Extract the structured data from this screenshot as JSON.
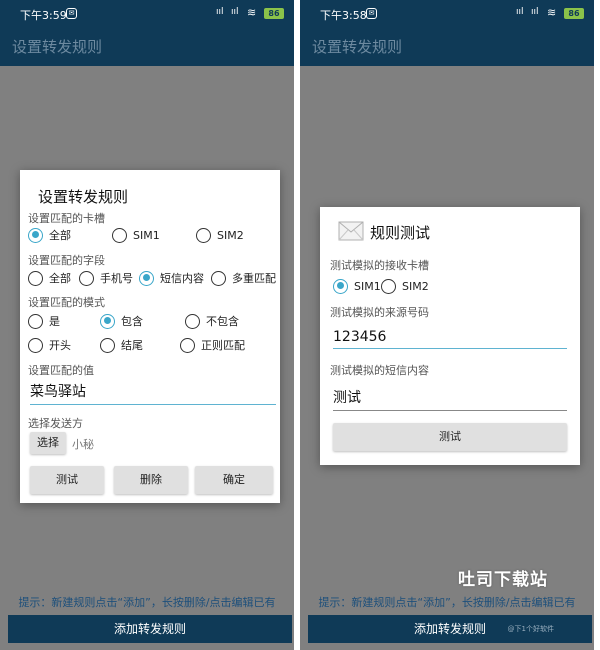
{
  "left": {
    "status": {
      "time": "下午3:59",
      "signal1": "ııl",
      "signal2": "ııl",
      "battery": "86"
    },
    "appbar_title": "设置转发规则",
    "dialog": {
      "title": "设置转发规则",
      "sim_label": "设置匹配的卡槽",
      "sim_options": [
        "全部",
        "SIM1",
        "SIM2"
      ],
      "sim_selected": "全部",
      "field_label": "设置匹配的字段",
      "field_options": [
        "全部",
        "手机号",
        "短信内容",
        "多重匹配"
      ],
      "field_selected": "短信内容",
      "mode_label": "设置匹配的模式",
      "mode_options": [
        "是",
        "包含",
        "不包含",
        "开头",
        "结尾",
        "正则匹配"
      ],
      "mode_selected": "包含",
      "value_label": "设置匹配的值",
      "value": "菜鸟驿站",
      "sender_label": "选择发送方",
      "select_button": "选择",
      "sender_value": "小秘",
      "buttons": {
        "test": "测试",
        "delete": "删除",
        "confirm": "确定"
      }
    },
    "hint": "提示：新建规则点击“添加”，长按删除/点击编辑已有",
    "bottom_button": "添加转发规则"
  },
  "right": {
    "status": {
      "time": "下午3:58",
      "signal1": "ııl",
      "signal2": "ııl",
      "battery": "86"
    },
    "appbar_title": "设置转发规则",
    "dialog": {
      "title": "规则测试",
      "sim_label": "测试模拟的接收卡槽",
      "sim_options": [
        "SIM1",
        "SIM2"
      ],
      "sim_selected": "SIM1",
      "from_label": "测试模拟的来源号码",
      "from_value": "123456",
      "content_label": "测试模拟的短信内容",
      "content_value": "测试",
      "test_button": "测试"
    },
    "hint": "提示：新建规则点击“添加”，长按删除/点击编辑已有",
    "bottom_button": "添加转发规则",
    "watermark_small": "@下1个好软件",
    "watermark_big": "吐司下载站"
  }
}
